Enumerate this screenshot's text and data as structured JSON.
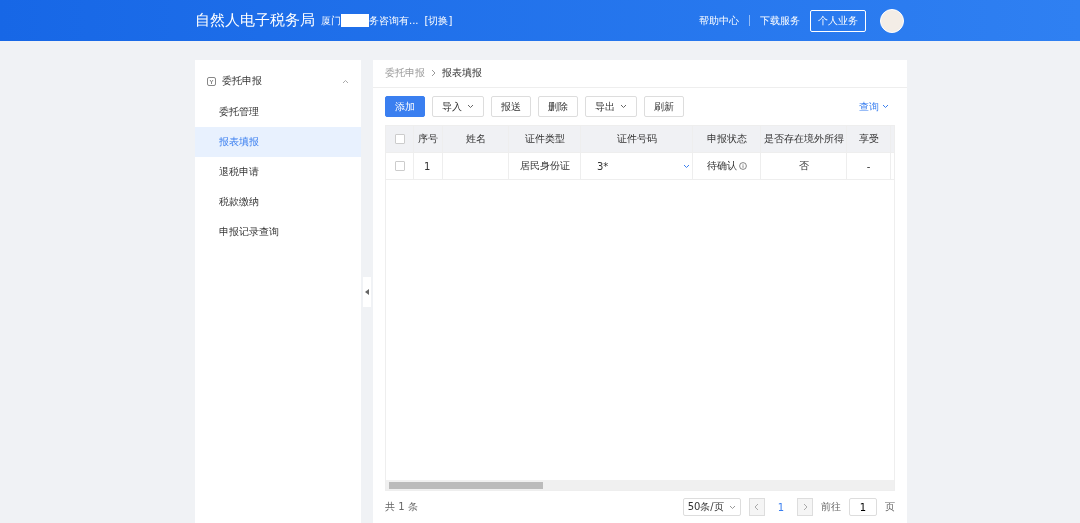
{
  "header": {
    "title": "自然人电子税务局",
    "org_prefix": "厦门",
    "org_suffix": "务咨询有...",
    "switch": "[切换]",
    "links": [
      "帮助中心",
      "下载服务"
    ],
    "personal_button": "个人业务"
  },
  "sidebar": {
    "group": {
      "label": "委托申报",
      "expanded": true
    },
    "items": [
      {
        "label": "委托管理",
        "selected": false
      },
      {
        "label": "报表填报",
        "selected": true
      },
      {
        "label": "退税申请",
        "selected": false
      },
      {
        "label": "税款缴纳",
        "selected": false
      },
      {
        "label": "申报记录查询",
        "selected": false
      }
    ]
  },
  "breadcrumb": [
    "委托申报",
    "报表填报"
  ],
  "toolbar": [
    {
      "label": "添加",
      "kind": "primary"
    },
    {
      "label": "导入",
      "kind": "dropdown"
    },
    {
      "label": "报送",
      "kind": "plain"
    },
    {
      "label": "删除",
      "kind": "plain"
    },
    {
      "label": "导出",
      "kind": "dropdown"
    },
    {
      "label": "刷新",
      "kind": "plain"
    }
  ],
  "query": "查询",
  "table": {
    "all_checked": false,
    "columns": [
      "序号",
      "姓名",
      "证件类型",
      "证件号码",
      "申报状态",
      "是否存在境外所得",
      "享受"
    ],
    "rows": [
      {
        "checked": false,
        "cells": [
          "1",
          "",
          "居民身份证",
          "3*",
          "待确认",
          "否",
          "-"
        ]
      }
    ]
  },
  "footer": {
    "total": "共 1 条",
    "page_size": "50条/页",
    "page": "1",
    "goto_label": "前往",
    "goto_value": "1",
    "page_unit": "页"
  }
}
